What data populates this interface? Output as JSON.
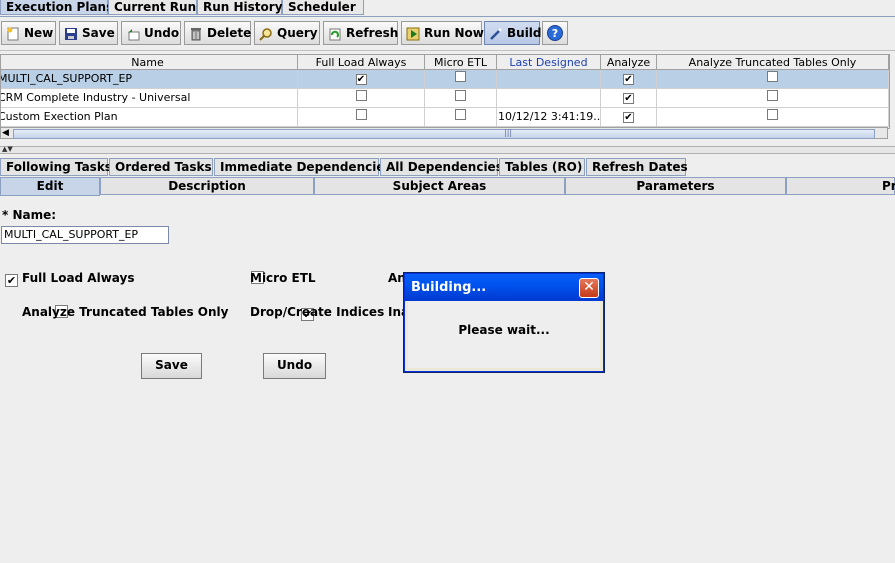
{
  "top_tabs": [
    "Execution Plans",
    "Current Run",
    "Run History",
    "Scheduler"
  ],
  "toolbar": {
    "new": "New",
    "save": "Save",
    "undo": "Undo",
    "delete": "Delete",
    "query": "Query",
    "refresh": "Refresh",
    "run_now": "Run Now",
    "build": "Build",
    "help": "?"
  },
  "grid": {
    "columns": [
      "Name",
      "Full Load Always",
      "Micro ETL",
      "Last Designed",
      "Analyze",
      "Analyze Truncated Tables Only"
    ],
    "rows": [
      {
        "name": "MULTI_CAL_SUPPORT_EP",
        "full_load": "✔",
        "micro_etl": "",
        "last_designed": "",
        "analyze": "✔",
        "truncated": ""
      },
      {
        "name": "CRM Complete Industry - Universal",
        "full_load": "",
        "micro_etl": "",
        "last_designed": "",
        "analyze": "✔",
        "truncated": ""
      },
      {
        "name": "Custom Exection Plan",
        "full_load": "",
        "micro_etl": "",
        "last_designed": "10/12/12 3:41:19...",
        "analyze": "✔",
        "truncated": ""
      }
    ],
    "scroll_grip": "|||"
  },
  "lower_tabs_row1": [
    "Following Tasks",
    "Ordered Tasks",
    "Immediate Dependencies",
    "All Dependencies",
    "Tables (RO)",
    "Refresh Dates"
  ],
  "lower_tabs_row2": [
    "Edit",
    "Description",
    "Subject Areas",
    "Parameters",
    "Pr"
  ],
  "form": {
    "name_label": "* Name:",
    "name_value": "MULTI_CAL_SUPPORT_EP",
    "full_load_label": "Full Load Always",
    "micro_etl_label": "Micro ETL",
    "analyze_label": "Ana",
    "analyze_trunc_label": "Analyze Truncated Tables Only",
    "drop_create_label": "Drop/Create Indices",
    "inactive_label": "Ina",
    "check_on": "✔",
    "save": "Save",
    "undo": "Undo"
  },
  "dialog": {
    "title": "Building...",
    "close": "✕",
    "message": "Please wait..."
  }
}
